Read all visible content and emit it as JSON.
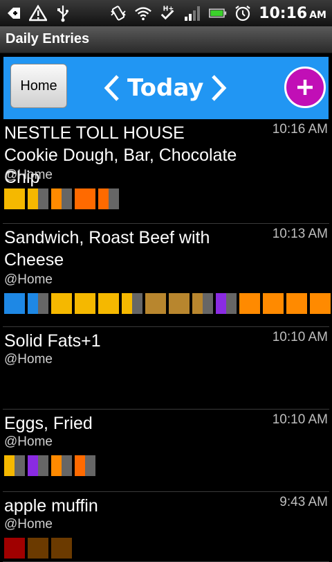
{
  "statusbar": {
    "time": "10:16",
    "ampm": "AM"
  },
  "app": {
    "title": "Daily Entries"
  },
  "toolbar": {
    "home_label": "Home",
    "day_label": "Today"
  },
  "colors": {
    "toolbar": "#2196f3",
    "add_button": "#c10fb6",
    "yellow": "#f5b800",
    "orange": "#ff8a00",
    "dark_orange": "#ff6a00",
    "blue": "#1e88e5",
    "tan": "#b8862e",
    "purple": "#8a2be2",
    "gray": "#666666",
    "red": "#a00000",
    "brown": "#6b3a00"
  },
  "entries": [
    {
      "name": "NESTLE TOLL HOUSE Cookie Dough, Bar, Chocolate Chip",
      "time": "10:16 AM",
      "location": "@Home",
      "bars": [
        "yellow",
        "yellow|gray",
        "orange|gray",
        "dark_orange",
        "dark_orange|gray"
      ]
    },
    {
      "name": "Sandwich, Roast Beef with Cheese",
      "time": "10:13 AM",
      "location": "@Home",
      "bars": [
        "blue",
        "blue|gray",
        "yellow",
        "yellow",
        "yellow",
        "yellow|gray",
        "tan",
        "tan",
        "tan|gray",
        "purple|gray",
        "orange",
        "orange",
        "orange",
        "orange"
      ]
    },
    {
      "name": "Solid Fats+1",
      "time": "10:10 AM",
      "location": "@Home",
      "bars": []
    },
    {
      "name": "Eggs, Fried",
      "time": "10:10 AM",
      "location": "@Home",
      "bars": [
        "yellow|gray",
        "purple|gray",
        "orange|gray",
        "dark_orange|gray"
      ]
    },
    {
      "name": "apple muffin",
      "time": "9:43 AM",
      "location": "@Home",
      "bars": [
        "red",
        "brown",
        "brown"
      ]
    }
  ]
}
